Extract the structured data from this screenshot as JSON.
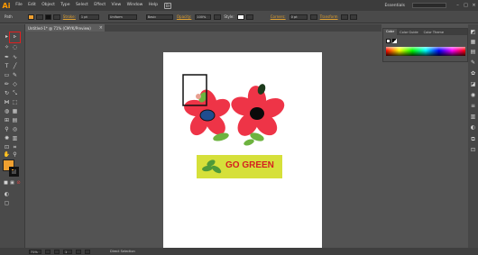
{
  "app": {
    "logo": "Ai"
  },
  "menu": [
    "File",
    "Edit",
    "Object",
    "Type",
    "Select",
    "Effect",
    "View",
    "Window",
    "Help"
  ],
  "bridge_label": "Br",
  "workspace": {
    "label": "Essentials"
  },
  "window_controls": [
    "–",
    "□",
    "×"
  ],
  "control_bar": {
    "selection_label": "Path",
    "stroke_label": "Stroke:",
    "stroke_value": "1 pt",
    "profile_value": "Uniform",
    "brush_value": "Basic",
    "opacity_label": "Opacity:",
    "opacity_value": "100%",
    "style_label": "Style:",
    "corners_label": "Corners:",
    "corners_value": "0 pt",
    "transform_label": "Transform"
  },
  "document_tab": {
    "label": "Untitled-1* @ 71% (CMYK/Preview)",
    "close": "×"
  },
  "colors": {
    "fill": "#f0a030",
    "stroke": "#111111",
    "flower_red": "#ee3447",
    "flower_center_blue": "#1f4d8f",
    "leaf_green": "#6db33f",
    "banner_yellow": "#d6e03a",
    "banner_text": "#d42020",
    "selection_red": "#e02020"
  },
  "artwork": {
    "banner_text": "GO GREEN"
  },
  "color_panel": {
    "tabs": [
      "Color",
      "Color Guide",
      "Color Theme"
    ]
  },
  "status_bar": {
    "zoom": "71%",
    "page": "1",
    "status": "Direct Selection"
  },
  "tools": {
    "selection": "selection-tool-icon",
    "direct_selection": "direct-selection-tool-icon"
  }
}
